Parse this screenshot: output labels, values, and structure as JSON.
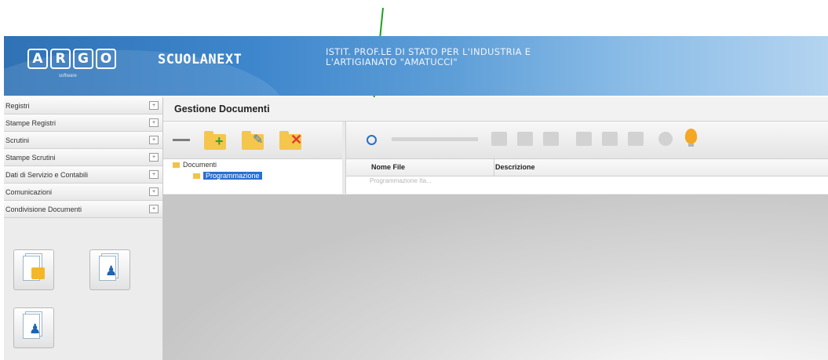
{
  "banner": {
    "logo_letters": [
      "A",
      "R",
      "G",
      "O"
    ],
    "logo_sub": "software",
    "product": "SCUOLANEXT",
    "school_line1": "ISTIT. PROF.LE DI STATO PER L'INDUSTRIA E",
    "school_line2": "L'ARTIGIANATO \"AMATUCCI\""
  },
  "sidebar": {
    "items": [
      {
        "label": "Registri",
        "icon": "plus-icon"
      },
      {
        "label": "Stampe Registri",
        "icon": "plus-icon"
      },
      {
        "label": "Scrutini",
        "icon": "plus-icon"
      },
      {
        "label": "Stampe Scrutini",
        "icon": "plus-icon"
      },
      {
        "label": "Dati di Servizio e Contabili",
        "icon": "plus-icon"
      },
      {
        "label": "Comunicazioni",
        "icon": "plus-icon"
      },
      {
        "label": "Condivisione Documenti",
        "icon": "plus-icon"
      }
    ],
    "shortcuts": [
      "document-lock-icon",
      "document-user-icon",
      "document-users-icon"
    ]
  },
  "panel": {
    "title": "Gestione Documenti",
    "tree": {
      "root": "Documenti",
      "child": "Programmazione"
    },
    "grid": {
      "columns": [
        "Nome File",
        "Descrizione"
      ],
      "first_row_fragment": "Programmazione Ita..."
    }
  },
  "colors": {
    "banner_blue": "#3e86cc",
    "selection_blue": "#2a6fd1",
    "annotation_green": "#1ca11c"
  }
}
